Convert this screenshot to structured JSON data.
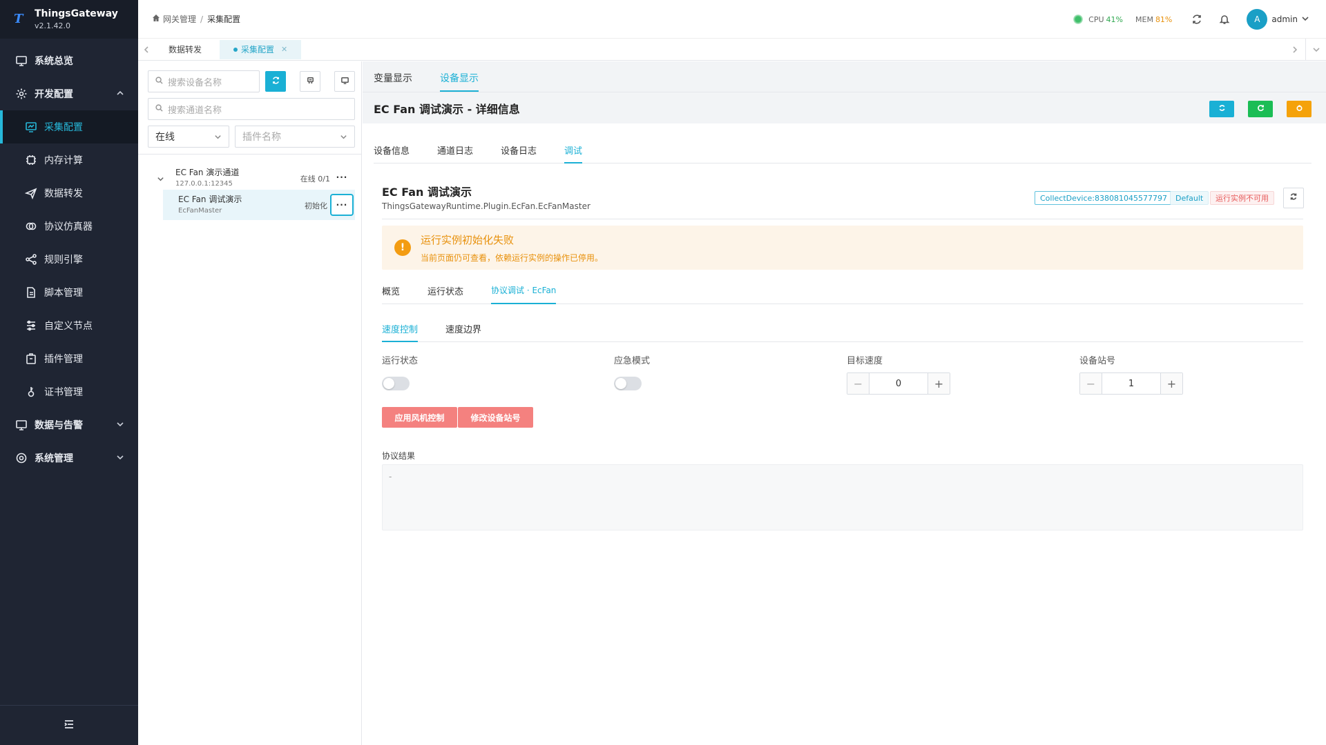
{
  "app": {
    "name": "ThingsGateway",
    "version": "v2.1.42.0"
  },
  "sidebar": {
    "items": [
      {
        "label": "系统总览"
      },
      {
        "label": "开发配置"
      },
      {
        "label": "采集配置"
      },
      {
        "label": "内存计算"
      },
      {
        "label": "数据转发"
      },
      {
        "label": "协议仿真器"
      },
      {
        "label": "规则引擎"
      },
      {
        "label": "脚本管理"
      },
      {
        "label": "自定义节点"
      },
      {
        "label": "插件管理"
      },
      {
        "label": "证书管理"
      },
      {
        "label": "数据与告警"
      },
      {
        "label": "系统管理"
      }
    ]
  },
  "header": {
    "breadcrumb": [
      "网关管理",
      "采集配置"
    ],
    "cpu_label": "CPU",
    "cpu_value": "41%",
    "mem_label": "MEM",
    "mem_value": "81%",
    "avatar_letter": "A",
    "username": "admin"
  },
  "pagetabs": [
    {
      "label": "数据转发"
    },
    {
      "label": "采集配置"
    }
  ],
  "left": {
    "device_search_placeholder": "搜索设备名称",
    "channel_search_placeholder": "搜索通道名称",
    "status_select": "在线",
    "plugin_select_placeholder": "插件名称",
    "channel": {
      "name": "EC Fan 演示通道",
      "address": "127.0.0.1:12345",
      "status": "在线 0/1"
    },
    "device": {
      "name": "EC Fan 调试演示",
      "plugin": "EcFanMaster",
      "status": "初始化"
    }
  },
  "right": {
    "view_tabs": [
      "变量显示",
      "设备显示"
    ],
    "detail_title": "EC Fan 调试演示 - 详细信息",
    "detail_tabs": [
      "设备信息",
      "通道日志",
      "设备日志",
      "调试"
    ],
    "device_title": "EC Fan 调试演示",
    "device_class": "ThingsGatewayRuntime.Plugin.EcFan.EcFanMaster",
    "tags": [
      "CollectDevice:838081045577797",
      "Default",
      "运行实例不可用"
    ],
    "alert_title": "运行实例初始化失败",
    "alert_desc": "当前页面仍可查看，依赖运行实例的操作已停用。",
    "debug_tabs": [
      "概览",
      "运行状态",
      "协议调试 · EcFan"
    ],
    "sub_tabs": [
      "速度控制",
      "速度边界"
    ],
    "fields": {
      "run_state": "运行状态",
      "emergency": "应急模式",
      "target_speed": "目标速度",
      "station": "设备站号",
      "target_speed_value": "0",
      "station_value": "1"
    },
    "buttons": {
      "apply": "应用风机控制",
      "modify": "修改设备站号"
    },
    "result_label": "协议结果",
    "result_value": "-"
  }
}
